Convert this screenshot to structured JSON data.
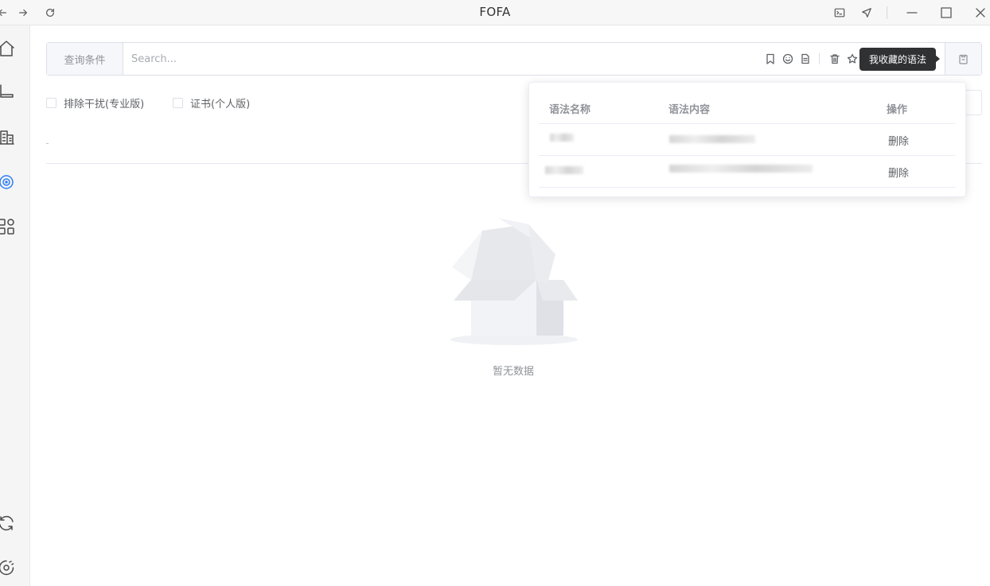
{
  "window": {
    "title": "FOFA"
  },
  "search": {
    "prefix_label": "查询条件",
    "placeholder": "Search...",
    "value": ""
  },
  "tooltip": {
    "text": "我收藏的语法"
  },
  "filters": [
    {
      "label": "排除干扰(专业版)",
      "checked": false
    },
    {
      "label": "证书(个人版)",
      "checked": false
    }
  ],
  "saved_syntax": {
    "columns": [
      "语法名称",
      "语法内容",
      "操作"
    ],
    "rows": [
      {
        "name": "",
        "content": "",
        "action": "删除",
        "redacted": true
      },
      {
        "name": "",
        "content": "",
        "action": "删除",
        "redacted": true
      }
    ]
  },
  "empty_state": {
    "text": "暂无数据"
  },
  "sidebar": {
    "items": [
      {
        "icon": "home-icon",
        "active": false
      },
      {
        "icon": "device-icon",
        "active": false
      },
      {
        "icon": "building-icon",
        "active": false
      },
      {
        "icon": "target-icon",
        "active": true
      },
      {
        "icon": "apps-icon",
        "active": false
      },
      {
        "icon": "refresh-icon",
        "active": false
      },
      {
        "icon": "settings-icon",
        "active": false
      }
    ]
  },
  "colors": {
    "accent": "#2f7df6",
    "tooltip_bg": "#303133"
  }
}
